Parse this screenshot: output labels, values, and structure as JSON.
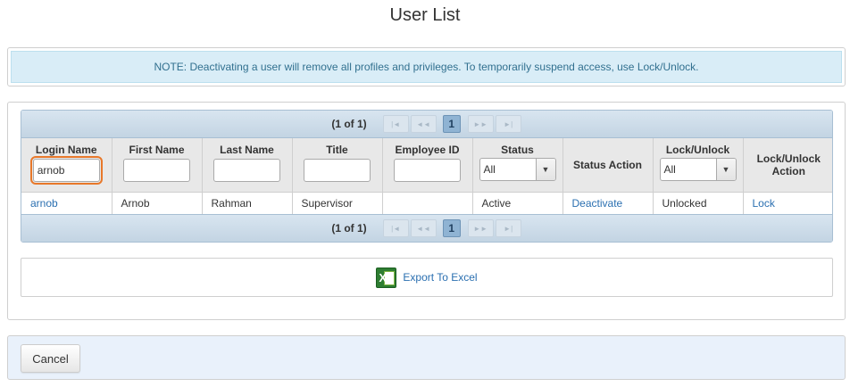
{
  "page": {
    "title": "User List"
  },
  "notice": {
    "text": "NOTE: Deactivating a user will remove all profiles and privileges. To temporarily suspend access, use Lock/Unlock."
  },
  "pager": {
    "count": "(1 of 1)",
    "current_page": "1",
    "first_icon": "first-page-icon",
    "prev_icon": "prev-page-icon",
    "next_icon": "next-page-icon",
    "last_icon": "last-page-icon"
  },
  "table": {
    "columns": {
      "login_name": "Login Name",
      "first_name": "First Name",
      "last_name": "Last Name",
      "title": "Title",
      "employee_id": "Employee ID",
      "status": "Status",
      "status_action": "Status Action",
      "lock_unlock": "Lock/Unlock",
      "lock_unlock_action": "Lock/Unlock Action"
    },
    "filters": {
      "login_name": "arnob",
      "first_name": "",
      "last_name": "",
      "title": "",
      "employee_id": "",
      "status": "All",
      "lock_unlock": "All"
    },
    "rows": [
      {
        "login_name": "arnob",
        "first_name": "Arnob",
        "last_name": "Rahman",
        "title": "Supervisor",
        "employee_id": "",
        "status": "Active",
        "status_action": "Deactivate",
        "lock_unlock": "Unlocked",
        "lock_unlock_action": "Lock"
      }
    ]
  },
  "export": {
    "label": "Export To Excel",
    "icon": "excel-icon"
  },
  "footer": {
    "cancel_label": "Cancel"
  },
  "colors": {
    "notice_bg": "#d9edf7",
    "notice_text": "#31708f",
    "link": "#2a6fb0",
    "pager_bg": "#c3d4e3",
    "focus_outline": "#e8782a"
  }
}
